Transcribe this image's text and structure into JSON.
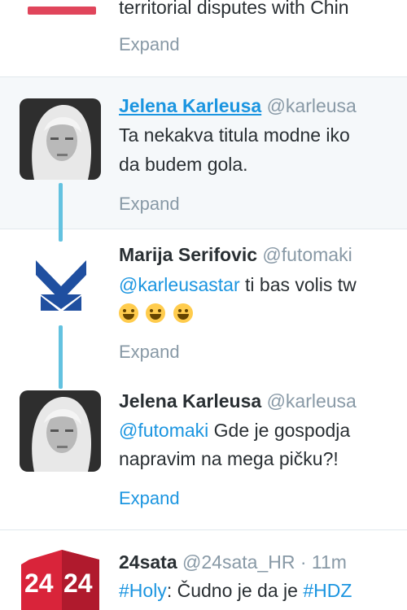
{
  "colors": {
    "link": "#1b95e0",
    "thread_line": "#63c2e0",
    "highlight_bg": "#f5f8fa",
    "muted": "#8899a6"
  },
  "tweets": [
    {
      "body_line1": "territorial disputes with Chin",
      "expand_label": "Expand"
    },
    {
      "name": "Jelena Karleusa",
      "handle": "@karleusa",
      "body_line1": "Ta nekakva titula modne iko",
      "body_line2": "da budem gola.",
      "expand_label": "Expand"
    },
    {
      "name": "Marija Serifovic",
      "handle": "@futomaki",
      "mention": "@karleusastar",
      "body_line1_rest": " ti bas volis tw",
      "emojis": [
        "face-with-tears-of-joy-emoji",
        "grinning-face-emoji",
        "smiley-emoji"
      ],
      "expand_label": "Expand"
    },
    {
      "name": "Jelena Karleusa",
      "handle": "@karleusa",
      "mention": "@futomaki",
      "body_line1_rest": " Gde je gospodja",
      "body_line2": "napravim na mega pičku?!",
      "expand_label": "Expand"
    },
    {
      "name": "24sata",
      "handle": "@24sata_HR",
      "dot": "·",
      "time": "11m",
      "hashtag1": "#Holy",
      "body_text": ": Čudno je da je ",
      "hashtag2": "#HDZ"
    }
  ]
}
